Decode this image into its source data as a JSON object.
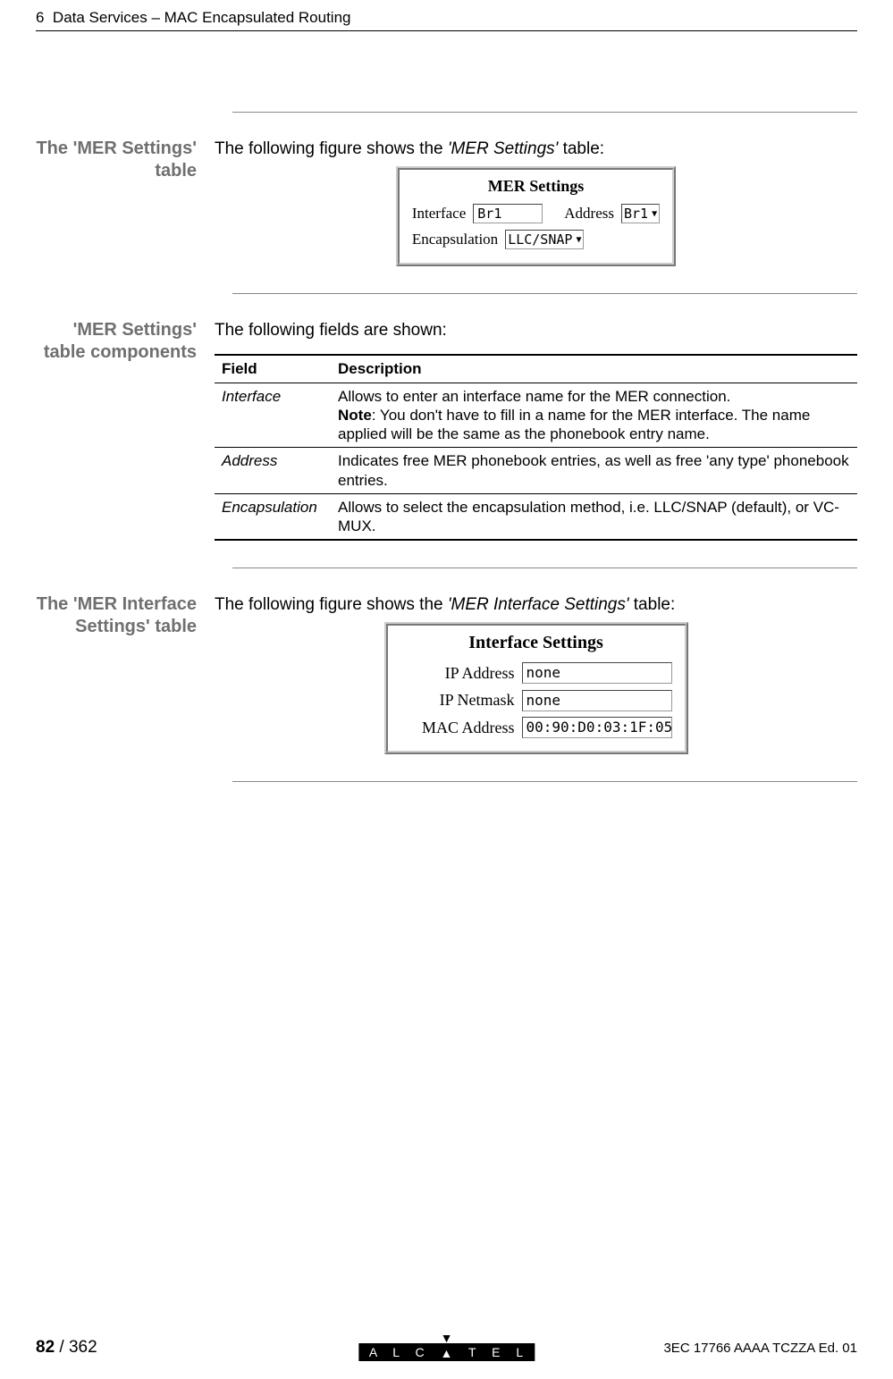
{
  "header": {
    "chapter_num": "6",
    "chapter_title": "Data Services – MAC Encapsulated Routing"
  },
  "block1": {
    "side": "The 'MER Settings' table",
    "intro_a": "The following figure shows the ",
    "intro_em": "'MER Settings'",
    "intro_b": " table:",
    "fig": {
      "title": "MER Settings",
      "interface_label": "Interface",
      "interface_value": "Br1",
      "address_label": "Address",
      "address_value": "Br1",
      "encaps_label": "Encapsulation",
      "encaps_value": "LLC/SNAP"
    }
  },
  "block2": {
    "side": "'MER Settings' table components",
    "intro": "The following fields are shown:",
    "th_field": "Field",
    "th_desc": "Description",
    "rows": [
      {
        "field": "Interface",
        "desc1": "Allows to enter an interface name for the MER connection.",
        "note_label": "Note",
        "note_rest": ": You don't have to fill in a name for the MER interface. The name applied will be the same as the phonebook entry name."
      },
      {
        "field": "Address",
        "desc1": "Indicates free MER phonebook entries, as well as free 'any type' phonebook entries."
      },
      {
        "field": "Encapsulation",
        "desc1": "Allows to select the encapsulation method, i.e. LLC/SNAP (default), or VC-MUX."
      }
    ]
  },
  "block3": {
    "side": "The 'MER Interface Settings' table",
    "intro_a": "The following figure shows the ",
    "intro_em": "'MER Interface Settings'",
    "intro_b": " table:",
    "fig": {
      "title": "Interface Settings",
      "ip_label": "IP Address",
      "ip_value": "none",
      "mask_label": "IP Netmask",
      "mask_value": "none",
      "mac_label": "MAC Address",
      "mac_value": "00:90:D0:03:1F:05"
    }
  },
  "footer": {
    "page": "82",
    "total": " / 362",
    "logo_text": "A L C   T E L",
    "doc_id": "3EC 17766 AAAA TCZZA Ed. 01"
  }
}
